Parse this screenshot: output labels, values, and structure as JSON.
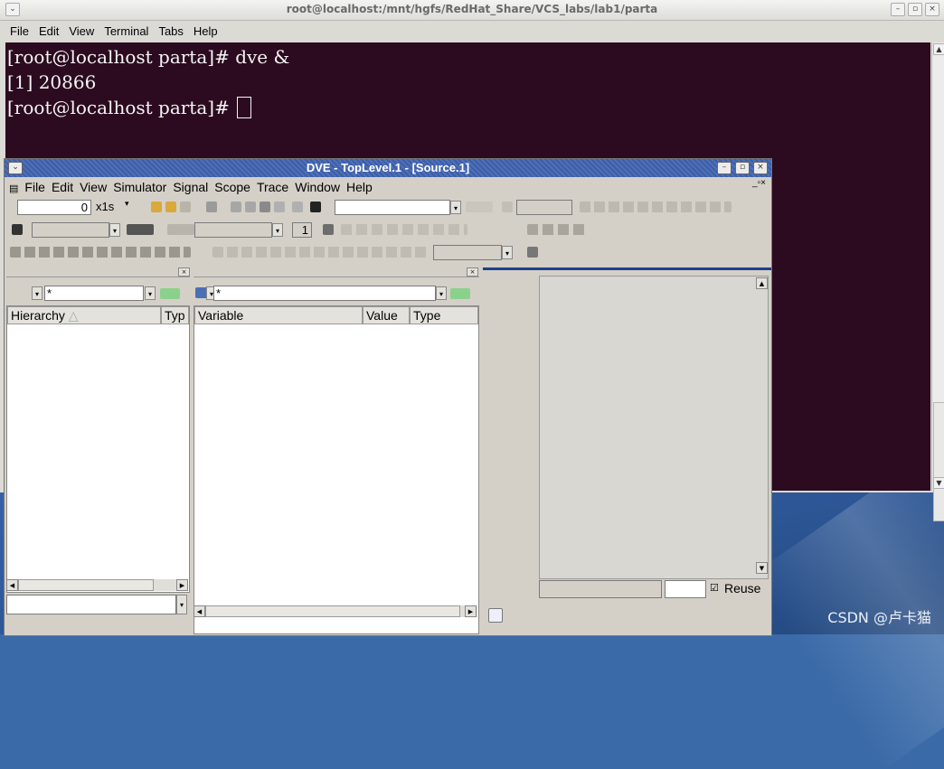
{
  "terminal": {
    "title": "root@localhost:/mnt/hgfs/RedHat_Share/VCS_labs/lab1/parta",
    "menu": [
      "File",
      "Edit",
      "View",
      "Terminal",
      "Tabs",
      "Help"
    ],
    "lines": [
      "[root@localhost parta]# dve &",
      "[1] 20866",
      "[root@localhost parta]# "
    ],
    "colors": {
      "background": "#2c0a1f",
      "text": "#f4f4f4"
    }
  },
  "dve": {
    "title": "DVE - TopLevel.1 - [Source.1]",
    "menu": [
      "File",
      "Edit",
      "View",
      "Simulator",
      "Signal",
      "Scope",
      "Trace",
      "Window",
      "Help"
    ],
    "toolbar": {
      "time_value": "0",
      "time_unit": "x1s",
      "step_count": "1"
    },
    "hierarchy": {
      "filter": "*",
      "columns": [
        "Hierarchy",
        "Typ"
      ]
    },
    "variables": {
      "filter": "*",
      "columns": [
        "Variable",
        "Value",
        "Type"
      ]
    },
    "source": {
      "reuse_label": "Reuse",
      "reuse_checked": true
    }
  },
  "watermark": "CSDN @卢卡猫"
}
